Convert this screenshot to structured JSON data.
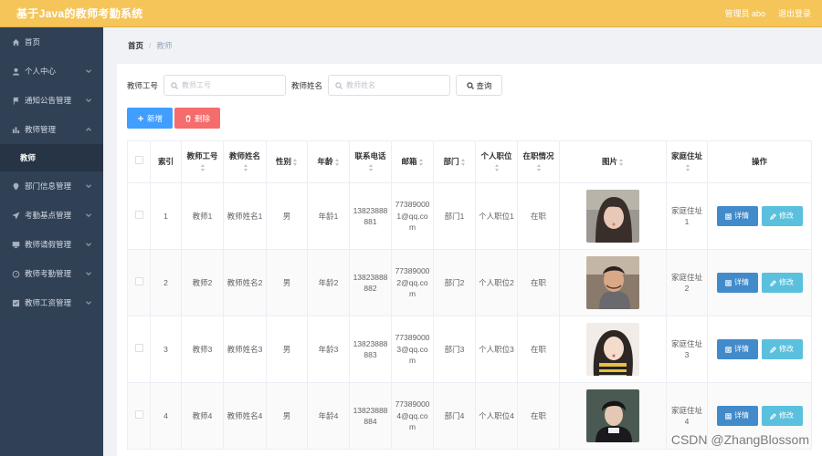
{
  "header": {
    "title": "基于Java的教师考勤系统",
    "user_label": "管理员 abo",
    "logout_label": "退出登录"
  },
  "sidebar": {
    "items": [
      {
        "label": "首页",
        "icon": "home-icon"
      },
      {
        "label": "个人中心",
        "icon": "user-icon"
      },
      {
        "label": "通知公告管理",
        "icon": "flag-icon"
      },
      {
        "label": "教师管理",
        "icon": "chart-icon"
      },
      {
        "label": "教师",
        "icon": ""
      },
      {
        "label": "部门信息管理",
        "icon": "pin-icon"
      },
      {
        "label": "考勤基点管理",
        "icon": "send-icon"
      },
      {
        "label": "教师请假管理",
        "icon": "monitor-icon"
      },
      {
        "label": "教师考勤管理",
        "icon": "gauge-icon"
      },
      {
        "label": "教师工资管理",
        "icon": "check-icon"
      }
    ]
  },
  "breadcrumb": {
    "home": "首页",
    "separator": "/",
    "current": "教师"
  },
  "search": {
    "field1_label": "教师工号",
    "field1_placeholder": "教师工号",
    "field2_label": "教师姓名",
    "field2_placeholder": "教师姓名",
    "query_label": "查询"
  },
  "actions": {
    "add_label": "新增",
    "delete_label": "删除"
  },
  "table": {
    "headers": {
      "index": "索引",
      "teacher_no": "教师工号",
      "teacher_name": "教师姓名",
      "gender": "性别",
      "age": "年龄",
      "phone": "联系电话",
      "email": "邮箱",
      "dept": "部门",
      "title": "个人职位",
      "status": "在职情况",
      "photo": "图片",
      "address": "家庭住址",
      "ops": "操作"
    },
    "detail_label": "详情",
    "edit_label": "修改",
    "rows": [
      {
        "index": "1",
        "teacher_no": "教师1",
        "teacher_name": "教师姓名1",
        "gender": "男",
        "age": "年龄1",
        "phone": "13823888881",
        "email": "773890001@qq.com",
        "dept": "部门1",
        "title": "个人职位1",
        "status": "在职",
        "address": "家庭住址1"
      },
      {
        "index": "2",
        "teacher_no": "教师2",
        "teacher_name": "教师姓名2",
        "gender": "男",
        "age": "年龄2",
        "phone": "13823888882",
        "email": "773890002@qq.com",
        "dept": "部门2",
        "title": "个人职位2",
        "status": "在职",
        "address": "家庭住址2"
      },
      {
        "index": "3",
        "teacher_no": "教师3",
        "teacher_name": "教师姓名3",
        "gender": "男",
        "age": "年龄3",
        "phone": "13823888883",
        "email": "773890003@qq.com",
        "dept": "部门3",
        "title": "个人职位3",
        "status": "在职",
        "address": "家庭住址3"
      },
      {
        "index": "4",
        "teacher_no": "教师4",
        "teacher_name": "教师姓名4",
        "gender": "男",
        "age": "年龄4",
        "phone": "13823888884",
        "email": "773890004@qq.com",
        "dept": "部门4",
        "title": "个人职位4",
        "status": "在职",
        "address": "家庭住址4"
      }
    ]
  },
  "watermark": "CSDN @ZhangBlossom",
  "colors": {
    "header_bg": "#f5c55a",
    "sidebar_bg": "#304156",
    "primary": "#409eff",
    "danger": "#f56c6c",
    "detail_btn": "#428bca",
    "edit_btn": "#5bc0de"
  }
}
